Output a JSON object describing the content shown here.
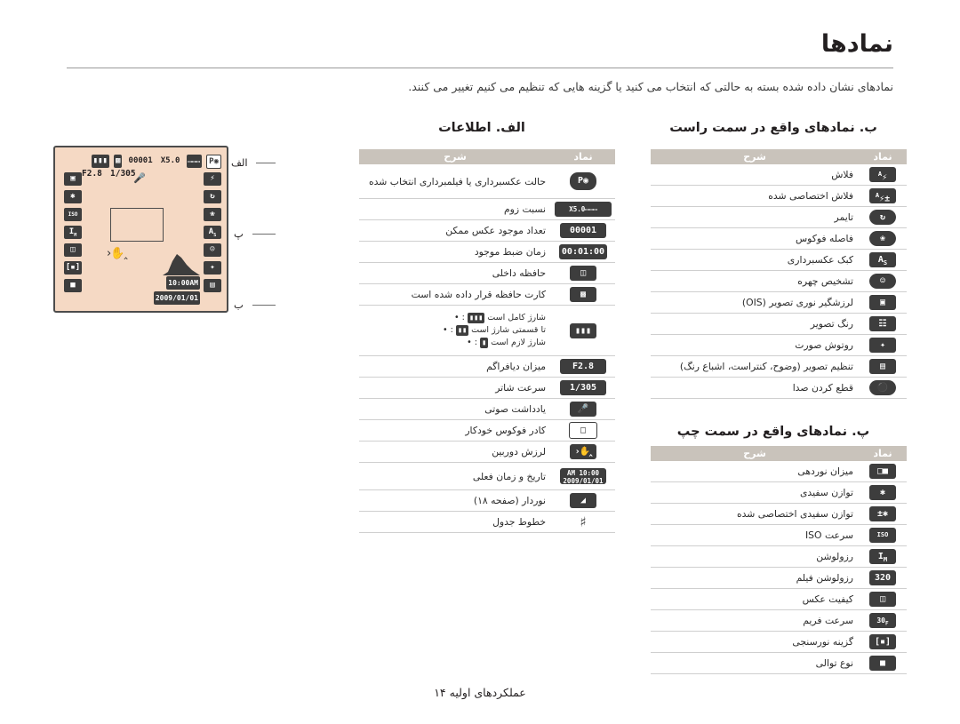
{
  "header": {
    "title": "نمادها",
    "intro": "نمادهای نشان داده شده بسته به حالتی که انتخاب می کنید یا گزینه هایی که تنظیم می کنیم تغییر می کنند."
  },
  "footer": {
    "text": "عملکردهای اولیه ۱۴"
  },
  "columns": {
    "icon": "نماد",
    "desc": "شرح"
  },
  "sections": {
    "a": {
      "heading": "الف. اطلاعات",
      "rows": [
        {
          "icon": "cam",
          "desc": "حالت عکسبرداری یا فیلمبرداری انتخاب شده"
        },
        {
          "icon": "zoombar",
          "desc": "نسبت زوم"
        },
        {
          "icon": "00001",
          "desc": "تعداد موجود عکس ممکن"
        },
        {
          "icon": "00:01:00",
          "desc": "زمان ضبط موجود"
        },
        {
          "icon": "mem",
          "desc": "حافظه داخلی"
        },
        {
          "icon": "card",
          "desc": "کارت حافظه قرار داده شده است"
        },
        {
          "icon": "battery",
          "desc": ""
        },
        {
          "icon": "F2.8",
          "desc": "میزان دیافراگم"
        },
        {
          "icon": "1/305",
          "desc": "سرعت شاتر"
        },
        {
          "icon": "mic",
          "desc": "یادداشت صوتی"
        },
        {
          "icon": "frame",
          "desc": "کادر فوکوس خودکار"
        },
        {
          "icon": "shake",
          "desc": "لرزش دوربین"
        },
        {
          "icon": "datetime",
          "desc": "تاریخ و زمان فعلی"
        },
        {
          "icon": "exposure",
          "desc": "نوردار (صفحه ۱۸)"
        },
        {
          "icon": "grid",
          "desc": "خطوط جدول"
        }
      ],
      "battery_bullets": [
        "شارژ کامل است",
        "تا قسمتی شارژ است",
        "شارژ لازم است"
      ]
    },
    "b": {
      "heading": "ب. نمادهای واقع در سمت راست",
      "rows": [
        {
          "icon": "flashA",
          "desc": "فلاش"
        },
        {
          "icon": "flashAe",
          "desc": "فلاش اختصاصی شده"
        },
        {
          "icon": "timer",
          "desc": "تایمر"
        },
        {
          "icon": "macro",
          "desc": "فاصله فوکوس"
        },
        {
          "icon": "af",
          "desc": "کبک عکسبرداری"
        },
        {
          "icon": "face",
          "desc": "تشخیص چهره"
        },
        {
          "icon": "ois",
          "desc": "لرزشگیر نوری تصویر (OIS)"
        },
        {
          "icon": "burst",
          "desc": "رنگ تصویر"
        },
        {
          "icon": "retouch",
          "desc": "روتوش صورت"
        },
        {
          "icon": "adjust",
          "desc": "تنظیم تصویر (وضوح، کنتراست، اشباع رنگ)"
        },
        {
          "icon": "sound",
          "desc": "قطع کردن صدا"
        }
      ]
    },
    "p": {
      "heading": "پ. نمادهای واقع در سمت چپ",
      "rows": [
        {
          "icon": "ev",
          "desc": "میزان نوردهی"
        },
        {
          "icon": "wb",
          "desc": "توازن سفیدی"
        },
        {
          "icon": "wbc",
          "desc": "توازن سفیدی اختصاصی شده"
        },
        {
          "icon": "iso",
          "desc": "سرعت ISO"
        },
        {
          "icon": "res",
          "desc": "رزولوشن"
        },
        {
          "icon": "320",
          "desc": "رزولوشن فیلم"
        },
        {
          "icon": "quality",
          "desc": "کیفیت عکس"
        },
        {
          "icon": "fps",
          "desc": "سرعت فریم"
        },
        {
          "icon": "metering",
          "desc": "گزینه نورسنجی"
        },
        {
          "icon": "drive",
          "desc": "نوع توالی"
        }
      ]
    }
  },
  "screen": {
    "labels": {
      "a": "الف",
      "p": "پ",
      "b": "ب"
    },
    "top": {
      "mode": "cam",
      "aperture": "F2.8",
      "shutter": "1/305",
      "zoom": "X5.0",
      "count": "00001",
      "card": "card",
      "battery": "battery"
    },
    "left_icons": [
      "ev",
      "wb",
      "iso",
      "res",
      "metering",
      "drive"
    ],
    "right_icons": [
      "flashA",
      "timer",
      "macro",
      "af",
      "face",
      "retouch",
      "adjust"
    ],
    "time": "10:00AM",
    "date": "2009/01/01"
  }
}
